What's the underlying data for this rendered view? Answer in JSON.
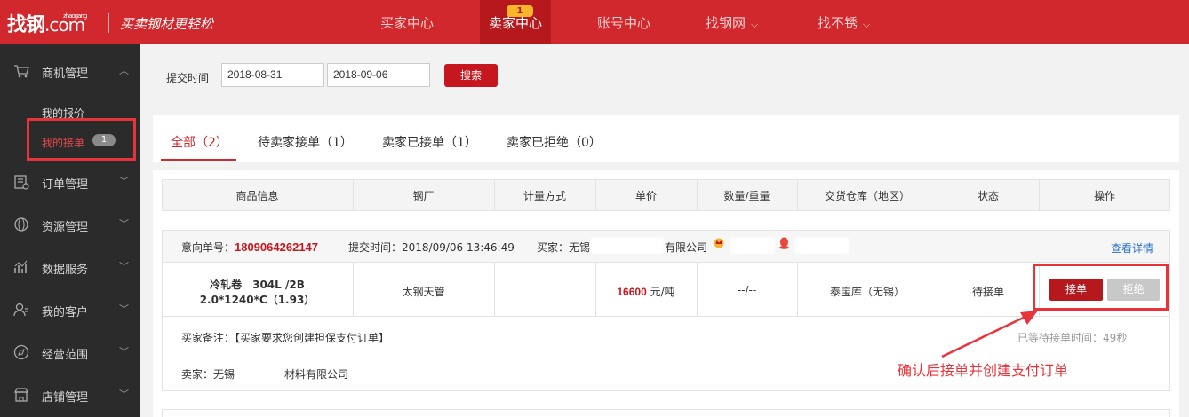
{
  "header": {
    "logo_main": "找钢",
    "logo_suffix": ".com",
    "logo_pinyin": "zhaogang",
    "slogan": "买卖钢材更轻松",
    "nav": [
      {
        "label": "买家中心"
      },
      {
        "label": "卖家中心",
        "badge": "1"
      },
      {
        "label": "账号中心"
      },
      {
        "label": "找钢网"
      },
      {
        "label": "找不锈"
      }
    ]
  },
  "sidebar": {
    "sections": [
      {
        "label": "商机管理",
        "icon": "cart-icon"
      },
      {
        "label": "订单管理",
        "icon": "order-icon"
      },
      {
        "label": "资源管理",
        "icon": "resource-icon"
      },
      {
        "label": "数据服务",
        "icon": "chart-icon"
      },
      {
        "label": "我的客户",
        "icon": "customer-icon"
      },
      {
        "label": "经营范围",
        "icon": "compass-icon"
      },
      {
        "label": "店铺管理",
        "icon": "shop-icon"
      }
    ],
    "subitems": [
      {
        "label": "我的报价"
      },
      {
        "label": "我的接单",
        "badge": "1"
      }
    ]
  },
  "filter": {
    "label": "提交时间",
    "start_date": "2018-08-31",
    "end_date": "2018-09-06",
    "search_label": "搜索"
  },
  "tabs": [
    {
      "label": "全部（2）"
    },
    {
      "label": "待卖家接单（1）"
    },
    {
      "label": "卖家已接单（1）"
    },
    {
      "label": "卖家已拒绝（0）"
    }
  ],
  "table": {
    "headers": [
      "商品信息",
      "钢厂",
      "计量方式",
      "单价",
      "数量/重量",
      "交货仓库（地区）",
      "状态",
      "操作"
    ]
  },
  "order": {
    "number_label": "意向单号：",
    "number": "1809064262147",
    "submit_time": "提交时间：2018/09/06 13:46:49",
    "buyer_prefix": "买家：无锡",
    "buyer_suffix": "有限公司",
    "detail_link": "查看详情",
    "product_line1": "冷轧卷　304L /2B",
    "product_line2": "2.0*1240*C（1.93）",
    "mill": "太钢天管",
    "measure": "",
    "price": "16600",
    "price_unit": " 元/吨",
    "quantity": "--/--",
    "warehouse": "泰宝库（无锡）",
    "status": "待接单",
    "accept_label": "接单",
    "reject_label": "拒绝",
    "remark": "买家备注：【买家要求您创建担保支付订单】",
    "wait_time": "已等待接单时间：49秒",
    "seller_prefix": "卖家：无锡",
    "seller_suffix": "材料有限公司"
  },
  "annotation": "确认后接单并创建支付订单",
  "colors": {
    "brand": "#d0282c",
    "brand_dark": "#b5191e",
    "annotation": "#e8333a",
    "sidebar": "#2b2b2b",
    "link": "#2a70c5"
  }
}
